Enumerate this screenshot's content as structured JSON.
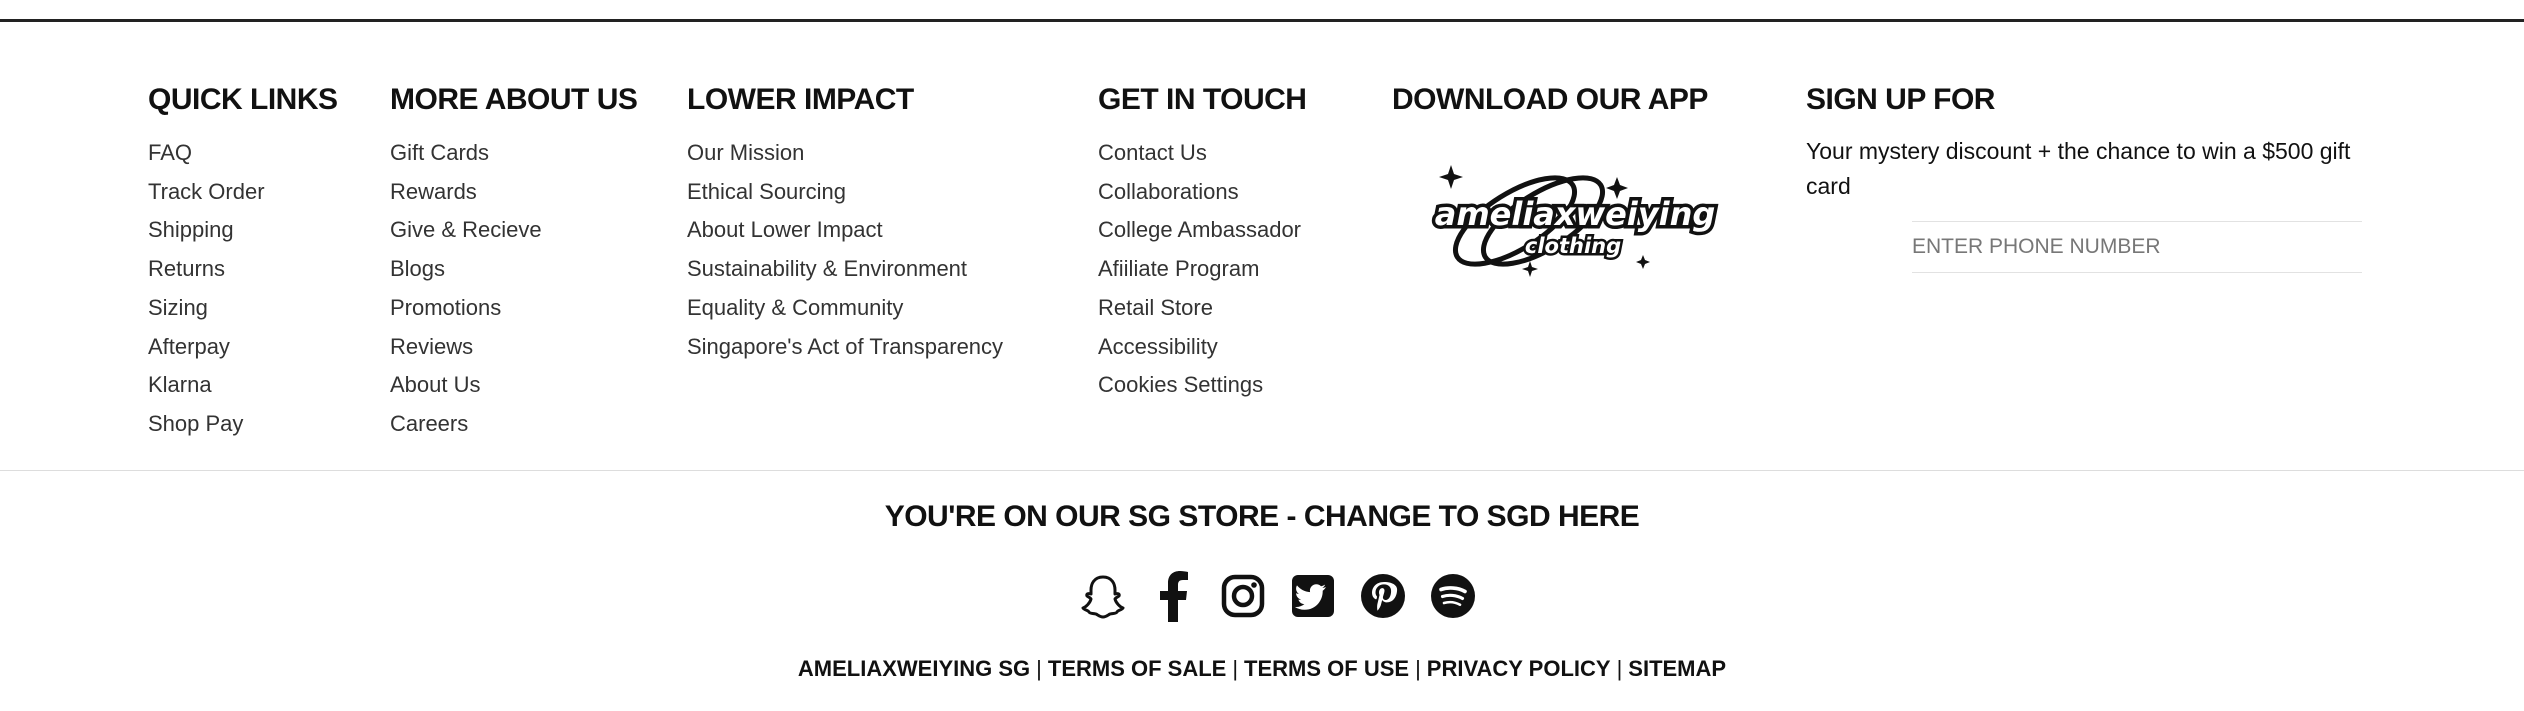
{
  "columns": [
    {
      "heading": "QUICK LINKS",
      "links": [
        "FAQ",
        "Track Order",
        "Shipping",
        "Returns",
        "Sizing",
        "Afterpay",
        "Klarna",
        "Shop Pay"
      ]
    },
    {
      "heading": "MORE ABOUT US",
      "links": [
        "Gift Cards",
        "Rewards",
        "Give & Recieve",
        "Blogs",
        "Promotions",
        "Reviews",
        "About Us",
        "Careers"
      ]
    },
    {
      "heading": "LOWER IMPACT",
      "links": [
        "Our Mission",
        "Ethical Sourcing",
        "About Lower Impact",
        "Sustainability & Environment",
        "Equality & Community",
        "Singapore's Act of Transparency"
      ]
    },
    {
      "heading": "GET IN TOUCH",
      "links": [
        "Contact Us",
        "Collaborations",
        "College Ambassador",
        "Afiiliate Program",
        "Retail Store",
        "Accessibility",
        "Cookies Settings"
      ]
    }
  ],
  "app": {
    "heading": "DOWNLOAD OUR APP",
    "logo_text": "ameliaxweiying",
    "logo_subtext": "clothing"
  },
  "signup": {
    "heading": "SIGN UP FOR",
    "text": "Your mystery discount + the chance to win a $500 gift card",
    "placeholder": "ENTER PHONE NUMBER"
  },
  "store_notice": "YOU'RE ON OUR SG STORE - CHANGE TO SGD HERE",
  "socials": [
    "snapchat-icon",
    "facebook-icon",
    "instagram-icon",
    "twitter-icon",
    "pinterest-icon",
    "spotify-icon"
  ],
  "legal": [
    "AMELIAXWEIYING SG",
    "TERMS OF SALE",
    "TERMS OF USE",
    "PRIVACY POLICY",
    "SITEMAP"
  ],
  "legal_separator": "|"
}
